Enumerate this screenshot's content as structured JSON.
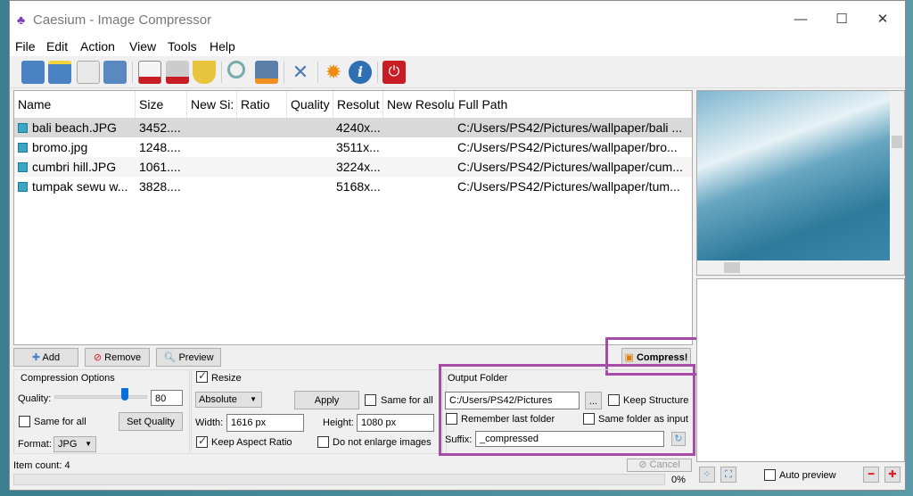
{
  "window": {
    "title": "Caesium - Image Compressor",
    "minimize": "—",
    "maximize": "☐",
    "close": "✕"
  },
  "menu": [
    "File",
    "Edit",
    "Action",
    "View",
    "Tools",
    "Help"
  ],
  "toolbar": [
    "open-files-icon",
    "add-folder-icon",
    "save-icon",
    "save-as-icon",
    "remove-item-icon",
    "clear-list-icon",
    "clean-icon",
    "preview-icon",
    "compress-image-icon",
    "settings-icon",
    "update-icon",
    "info-icon",
    "exit-icon"
  ],
  "table": {
    "headers": [
      "Name",
      "Size",
      "New Si:",
      "Ratio",
      "Quality",
      "Resolut",
      "New Resolu",
      "Full Path"
    ],
    "rows": [
      {
        "name": "bali beach.JPG",
        "size": "3452....",
        "resolution": "4240x...",
        "path": "C:/Users/PS42/Pictures/wallpaper/bali ..."
      },
      {
        "name": "bromo.jpg",
        "size": "1248....",
        "resolution": "3511x...",
        "path": "C:/Users/PS42/Pictures/wallpaper/bro..."
      },
      {
        "name": "cumbri hill.JPG",
        "size": "1061....",
        "resolution": "3224x...",
        "path": "C:/Users/PS42/Pictures/wallpaper/cum..."
      },
      {
        "name": "tumpak sewu w...",
        "size": "3828....",
        "resolution": "5168x...",
        "path": "C:/Users/PS42/Pictures/wallpaper/tum..."
      }
    ]
  },
  "buttons": {
    "add": "Add",
    "remove": "Remove",
    "preview": "Preview",
    "compress": "Compress!",
    "cancel": "Cancel"
  },
  "compression": {
    "title": "Compression Options",
    "quality_label": "Quality:",
    "quality": "80",
    "quality_slider_value": 80,
    "same_for_all": "Same for all",
    "set_quality": "Set Quality",
    "format_label": "Format:",
    "format": "JPG"
  },
  "resize": {
    "title": "Resize",
    "mode": "Absolute",
    "apply": "Apply",
    "same_for_all": "Same for all",
    "width_label": "Width:",
    "width": "1616 px",
    "height_label": "Height:",
    "height": "1080 px",
    "keep_aspect": "Keep Aspect Ratio",
    "no_enlarge": "Do not enlarge images"
  },
  "output": {
    "title": "Output Folder",
    "folder": "C:/Users/PS42/Pictures",
    "browse": "...",
    "keep_structure": "Keep Structure",
    "remember": "Remember last folder",
    "same_folder": "Same folder as input",
    "suffix_label": "Suffix:",
    "suffix": "_compressed"
  },
  "status": {
    "item_count": "Item count: 4",
    "progress": "0%",
    "progress_value": 0
  },
  "preview": {
    "auto_preview": "Auto preview"
  },
  "colors": {
    "highlight": "#a64ca6",
    "selected_row": "#d9d9d9"
  }
}
